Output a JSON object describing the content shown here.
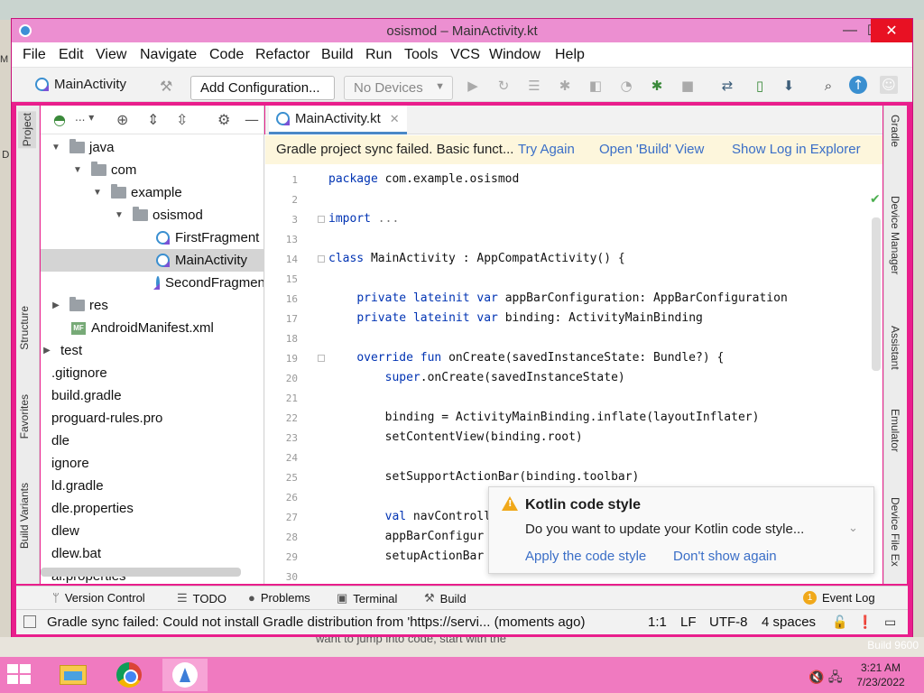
{
  "window": {
    "title": "osismod – MainActivity.kt",
    "min": "—",
    "max": "☐",
    "close": "✕"
  },
  "menu": [
    "File",
    "Edit",
    "View",
    "Navigate",
    "Code",
    "Refactor",
    "Build",
    "Run",
    "Tools",
    "VCS",
    "Window",
    "Help"
  ],
  "toolbar": {
    "breadcrumb": "MainActivity",
    "add_configuration": "Add Configuration...",
    "device_select": "No Devices"
  },
  "left_strip": {
    "project": "Project",
    "structure": "Structure",
    "favorites": "Favorites",
    "build_variants": "Build Variants"
  },
  "right_strip": {
    "gradle": "Gradle",
    "device_manager": "Device Manager",
    "assistant": "Assistant",
    "emulator": "Emulator",
    "device_file_explorer": "Device File Ex"
  },
  "project_tree": [
    {
      "label": "java",
      "indent": 1,
      "expanded": true,
      "type": "folder"
    },
    {
      "label": "com",
      "indent": 2,
      "expanded": true,
      "type": "folder"
    },
    {
      "label": "example",
      "indent": 3,
      "expanded": true,
      "type": "folder"
    },
    {
      "label": "osismod",
      "indent": 4,
      "expanded": true,
      "type": "folder"
    },
    {
      "label": "FirstFragment",
      "indent": 5,
      "type": "kotlin"
    },
    {
      "label": "MainActivity",
      "indent": 5,
      "type": "kotlin",
      "selected": true
    },
    {
      "label": "SecondFragment",
      "indent": 5,
      "type": "kotlin"
    },
    {
      "label": "res",
      "indent": 1,
      "expanded": false,
      "type": "folder"
    },
    {
      "label": "AndroidManifest.xml",
      "indent": 1,
      "type": "manifest"
    },
    {
      "label": "test",
      "indent": 0,
      "expanded": false,
      "type": "folder"
    },
    {
      "label": ".gitignore",
      "indent": 0,
      "type": "file"
    },
    {
      "label": "build.gradle",
      "indent": 0,
      "type": "file"
    },
    {
      "label": "proguard-rules.pro",
      "indent": 0,
      "type": "file"
    },
    {
      "label": "dle",
      "indent": 0,
      "type": "file"
    },
    {
      "label": "ignore",
      "indent": 0,
      "type": "file"
    },
    {
      "label": "ld.gradle",
      "indent": 0,
      "type": "file"
    },
    {
      "label": "dle.properties",
      "indent": 0,
      "type": "file"
    },
    {
      "label": "dlew",
      "indent": 0,
      "type": "file"
    },
    {
      "label": "dlew.bat",
      "indent": 0,
      "type": "file"
    },
    {
      "label": "al.properties",
      "indent": 0,
      "type": "file"
    }
  ],
  "editor": {
    "tab": "MainActivity.kt",
    "banner": {
      "message": "Gradle project sync failed. Basic funct...",
      "try_again": "Try Again",
      "open_build": "Open 'Build' View",
      "show_log": "Show Log in Explorer"
    },
    "lines": [
      {
        "n": "1",
        "text": "package com.example.osismod"
      },
      {
        "n": "2",
        "text": ""
      },
      {
        "n": "3",
        "text": "import ..."
      },
      {
        "n": "13",
        "text": ""
      },
      {
        "n": "14",
        "text": "class MainActivity : AppCompatActivity() {"
      },
      {
        "n": "15",
        "text": ""
      },
      {
        "n": "16",
        "text": "    private lateinit var appBarConfiguration: AppBarConfiguration"
      },
      {
        "n": "17",
        "text": "    private lateinit var binding: ActivityMainBinding"
      },
      {
        "n": "18",
        "text": ""
      },
      {
        "n": "19",
        "text": "    override fun onCreate(savedInstanceState: Bundle?) {"
      },
      {
        "n": "20",
        "text": "        super.onCreate(savedInstanceState)"
      },
      {
        "n": "21",
        "text": ""
      },
      {
        "n": "22",
        "text": "        binding = ActivityMainBinding.inflate(layoutInflater)"
      },
      {
        "n": "23",
        "text": "        setContentView(binding.root)"
      },
      {
        "n": "24",
        "text": ""
      },
      {
        "n": "25",
        "text": "        setSupportActionBar(binding.toolbar)"
      },
      {
        "n": "26",
        "text": ""
      },
      {
        "n": "27",
        "text": "        val navControll"
      },
      {
        "n": "28",
        "text": "        appBarConfigur"
      },
      {
        "n": "29",
        "text": "        setupActionBar"
      },
      {
        "n": "30",
        "text": ""
      }
    ]
  },
  "popup": {
    "title": "Kotlin code style",
    "message": "Do you want to update your Kotlin code style...",
    "apply": "Apply the code style",
    "dismiss": "Don't show again"
  },
  "bottom_tools": {
    "version_control": "Version Control",
    "todo": "TODO",
    "problems": "Problems",
    "terminal": "Terminal",
    "build": "Build",
    "event_log": "Event Log",
    "event_count": "1"
  },
  "status": {
    "message": "Gradle sync failed: Could not install Gradle distribution from 'https://servi... (moments ago)",
    "position": "1:1",
    "line_sep": "LF",
    "encoding": "UTF-8",
    "indent": "4 spaces"
  },
  "desktop": {
    "behind_text": "want to jump into code, start with the",
    "watermark": "Build 9600",
    "left_glyph": "M",
    "left_glyph2": "D"
  },
  "clock": {
    "time": "3:21 AM",
    "date": "7/23/2022"
  }
}
